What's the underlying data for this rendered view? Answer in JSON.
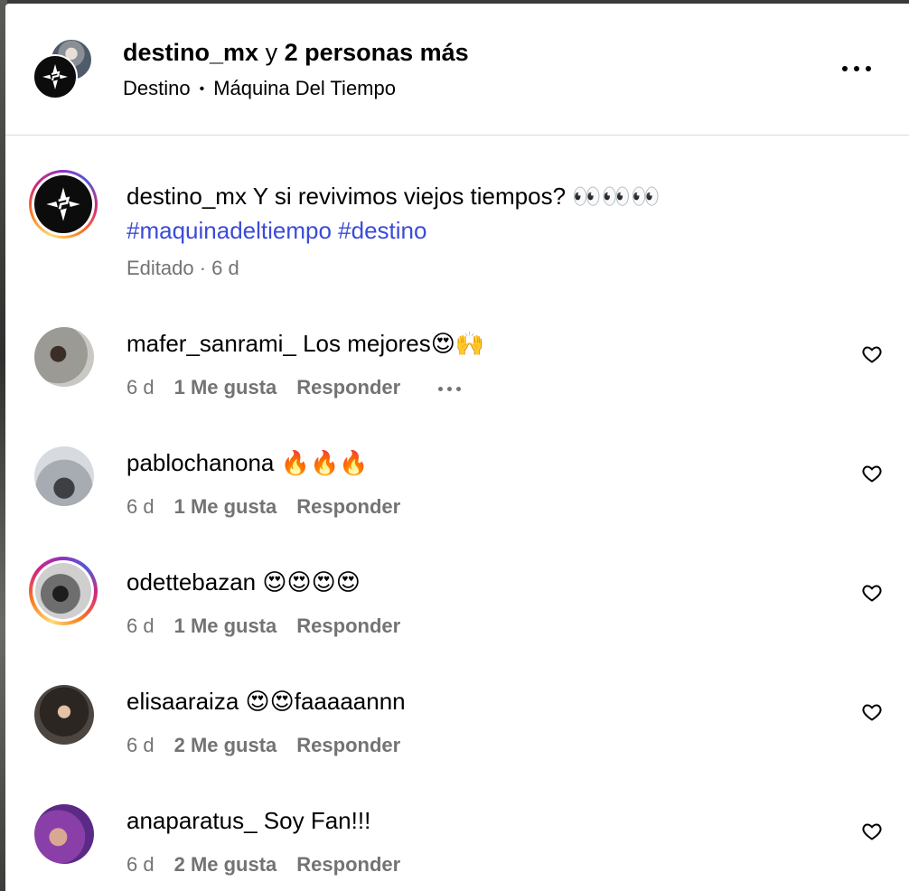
{
  "header": {
    "user": "destino_mx",
    "connector": "y",
    "others": "2 personas más",
    "subtitle_left": "Destino",
    "subtitle_sep": "•",
    "subtitle_right": "Máquina Del Tiempo"
  },
  "caption": {
    "user": "destino_mx",
    "text": "Y si revivimos viejos tiempos? 👀👀👀",
    "hashtags": [
      "#maquinadeltiempo",
      "#destino"
    ],
    "meta": "Editado · 6 d"
  },
  "comments": [
    {
      "user": "mafer_sanrami_",
      "text": "Los mejores😍🙌",
      "age": "6 d",
      "likes": "1 Me gusta",
      "reply": "Responder",
      "has_more": true
    },
    {
      "user": "pablochanona",
      "text": "🔥🔥🔥",
      "age": "6 d",
      "likes": "1 Me gusta",
      "reply": "Responder"
    },
    {
      "user": "odettebazan",
      "text": "😍😍😍😍",
      "age": "6 d",
      "likes": "1 Me gusta",
      "reply": "Responder"
    },
    {
      "user": "elisaaraiza",
      "text": "😍😍faaaaannn",
      "age": "6 d",
      "likes": "2 Me gusta",
      "reply": "Responder"
    },
    {
      "user": "anaparatus_",
      "text": "Soy Fan!!!",
      "age": "6 d",
      "likes": "2 Me gusta",
      "reply": "Responder"
    }
  ],
  "colors": {
    "hashtag": "#3b4bd8",
    "meta": "#737373",
    "divider": "#dbdbdb"
  },
  "icons": [
    "more-horizontal-icon",
    "heart-outline-icon",
    "destino-logo-icon"
  ]
}
